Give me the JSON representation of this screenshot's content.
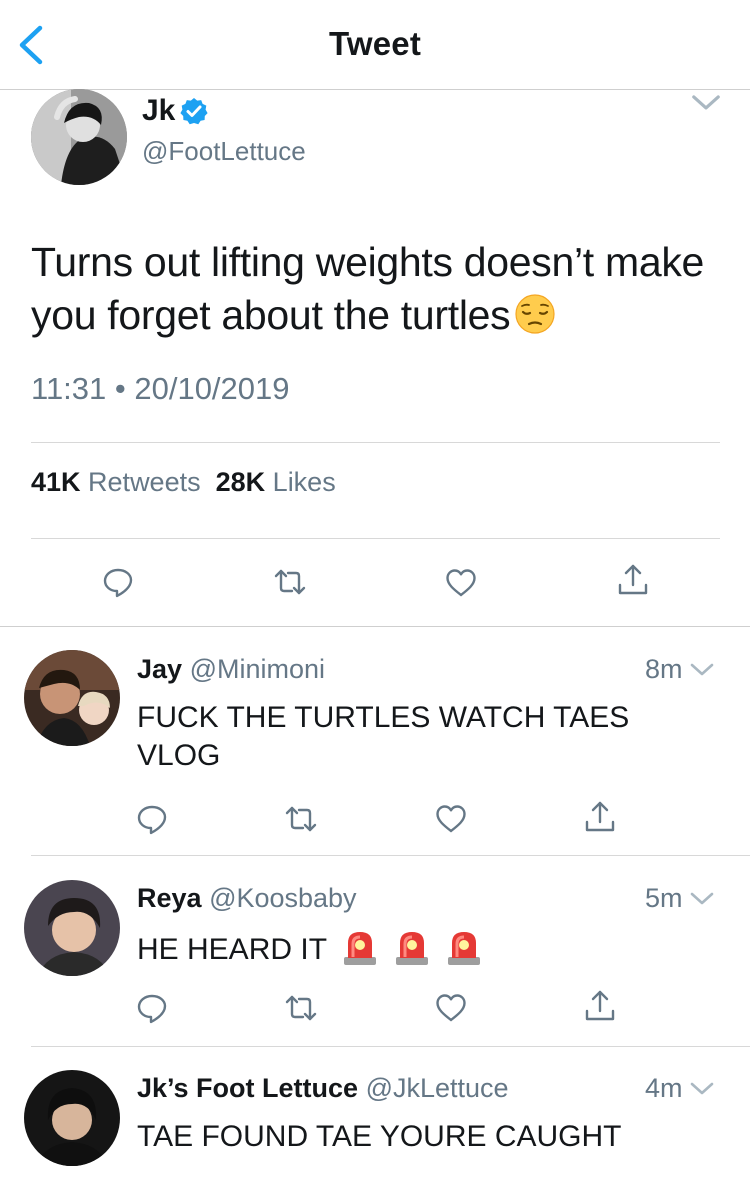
{
  "header": {
    "title": "Tweet"
  },
  "main_tweet": {
    "name": "Jk",
    "handle": "@FootLettuce",
    "text": "Turns out lifting weights doesn’t make you forget about the turtles",
    "timestamp": "11:31 • 20/10/2019",
    "retweets_count": "41K",
    "retweets_label": "Retweets",
    "likes_count": "28K",
    "likes_label": "Likes"
  },
  "replies": [
    {
      "name": "Jay",
      "handle": "@Minimoni",
      "time": "8m",
      "text": "FUCK THE TURTLES WATCH TAES VLOG"
    },
    {
      "name": "Reya",
      "handle": "@Koosbaby",
      "time": "5m",
      "text": "HE HEARD IT"
    },
    {
      "name": "Jk’s Foot Lettuce",
      "handle": "@JkLettuce",
      "time": "4m",
      "text": "TAE FOUND TAE YOURE CAUGHT"
    }
  ],
  "colors": {
    "accent": "#1da1f2",
    "secondary_text": "#657786",
    "primary_text": "#14171a"
  },
  "icons": [
    "back-chevron-icon",
    "verified-badge-icon",
    "chevron-down-icon",
    "reply-icon",
    "retweet-icon",
    "like-icon",
    "share-icon",
    "pensive-face-emoji",
    "police-light-emoji"
  ]
}
